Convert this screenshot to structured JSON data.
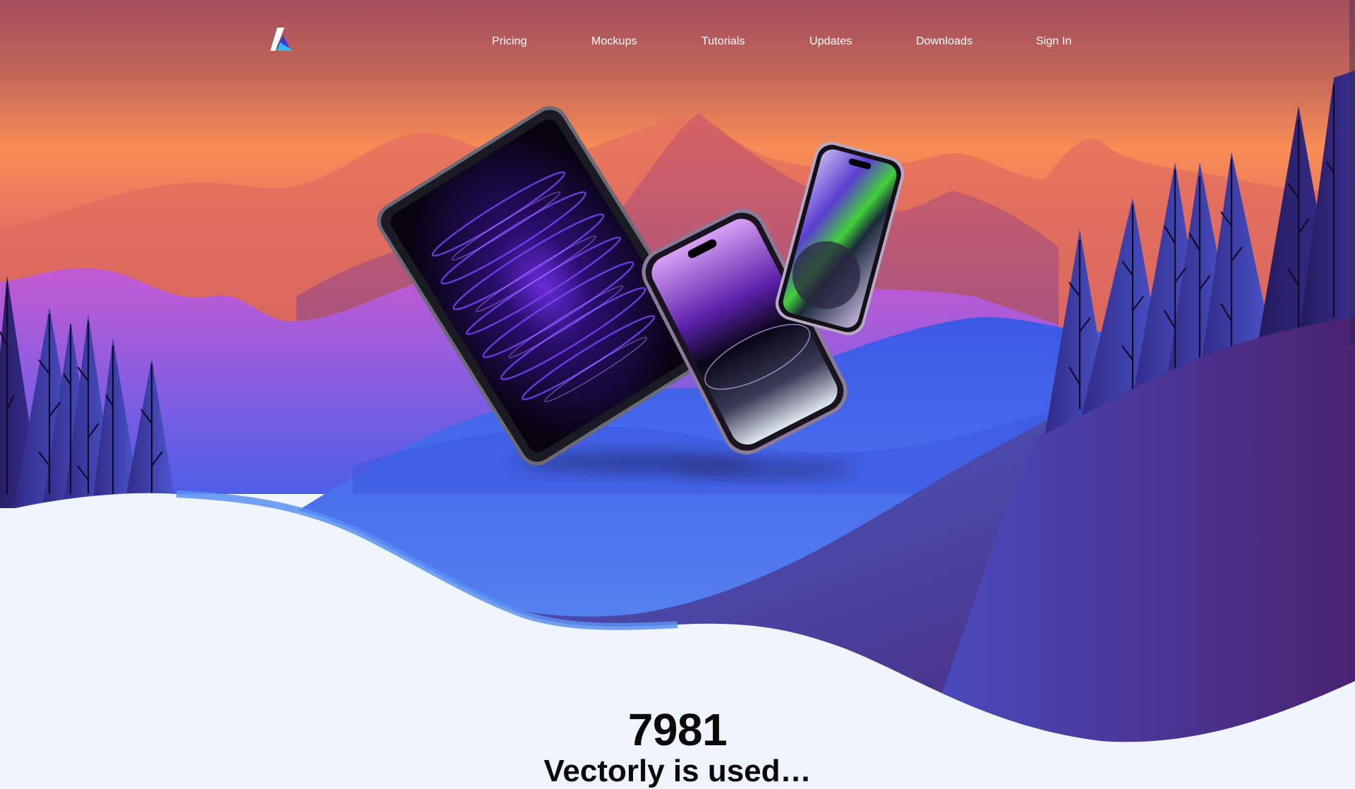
{
  "header": {
    "logo_icon": "triangle-logo-icon",
    "nav": [
      {
        "label": "Pricing"
      },
      {
        "label": "Mockups"
      },
      {
        "label": "Tutorials"
      },
      {
        "label": "Updates"
      },
      {
        "label": "Downloads"
      },
      {
        "label": "Sign In"
      }
    ]
  },
  "hero": {
    "devices": [
      "ipad-pro-mockup",
      "iphone-pro-mockup",
      "iphone-mockup"
    ]
  },
  "stats": {
    "number": "7981",
    "caption": "Vectorly is used…"
  },
  "colors": {
    "sky_top": "#a44d5e",
    "sky_horizon": "#f88d55",
    "mountains": "#e0705e",
    "hill_purple": "#b85ed0",
    "valley_blue": "#3e58e3",
    "snow": "#eff5fd",
    "foreground_hill": "#4a2574"
  }
}
